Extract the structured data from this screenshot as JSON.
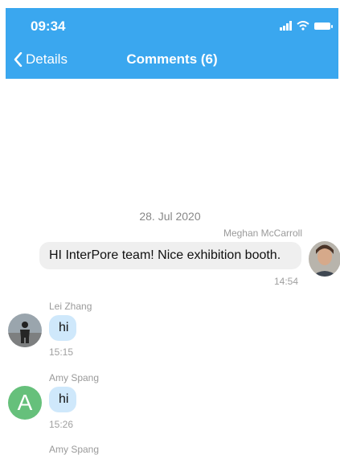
{
  "status_bar": {
    "time": "09:34"
  },
  "nav": {
    "back_label": "Details",
    "title": "Comments (6)"
  },
  "date_separator": "28. Jul 2020",
  "messages": [
    {
      "sender": "Meghan McCarroll",
      "text": "HI InterPore team!  Nice exhibition booth.",
      "time": "14:54"
    },
    {
      "sender": "Lei Zhang",
      "text": "hi",
      "time": "15:15"
    },
    {
      "sender": "Amy Spang",
      "text": "hi",
      "time": "15:26",
      "avatar_letter": "A"
    },
    {
      "sender": "Amy Spang"
    }
  ],
  "colors": {
    "nav_bar": "#3aa7ef",
    "incoming_bubble": "#cfe8fb",
    "outgoing_bubble": "#efefef",
    "letter_avatar": "#66c07b"
  }
}
